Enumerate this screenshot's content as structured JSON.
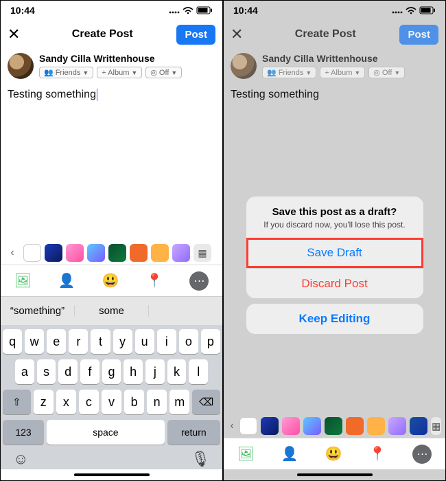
{
  "status": {
    "time": "10:44"
  },
  "header": {
    "title": "Create Post",
    "post_label": "Post"
  },
  "user": {
    "name": "Sandy Cilla Writtenhouse",
    "pill_friends": "Friends",
    "pill_album": "+ Album",
    "pill_off": "Off"
  },
  "post": {
    "text": "Testing something"
  },
  "keyboard": {
    "sugg1": "“something”",
    "sugg2": "some",
    "row1": [
      "q",
      "w",
      "e",
      "r",
      "t",
      "y",
      "u",
      "i",
      "o",
      "p"
    ],
    "row2": [
      "a",
      "s",
      "d",
      "f",
      "g",
      "h",
      "j",
      "k",
      "l"
    ],
    "row3": [
      "z",
      "x",
      "c",
      "v",
      "b",
      "n",
      "m"
    ],
    "num": "123",
    "space": "space",
    "ret": "return"
  },
  "sheet": {
    "title": "Save this post as a draft?",
    "subtitle": "If you discard now, you'll lose this post.",
    "save": "Save Draft",
    "discard": "Discard Post",
    "keep": "Keep Editing"
  }
}
